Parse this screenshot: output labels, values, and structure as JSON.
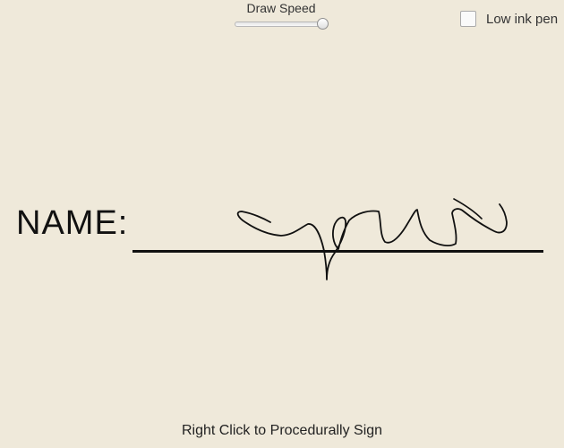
{
  "controls": {
    "speed_label": "Draw Speed",
    "speed_value": 1.0,
    "low_ink_label": "Low ink pen",
    "low_ink_checked": false
  },
  "signature_area": {
    "name_label": "NAME:"
  },
  "footer": {
    "hint": "Right Click to Procedurally Sign"
  }
}
